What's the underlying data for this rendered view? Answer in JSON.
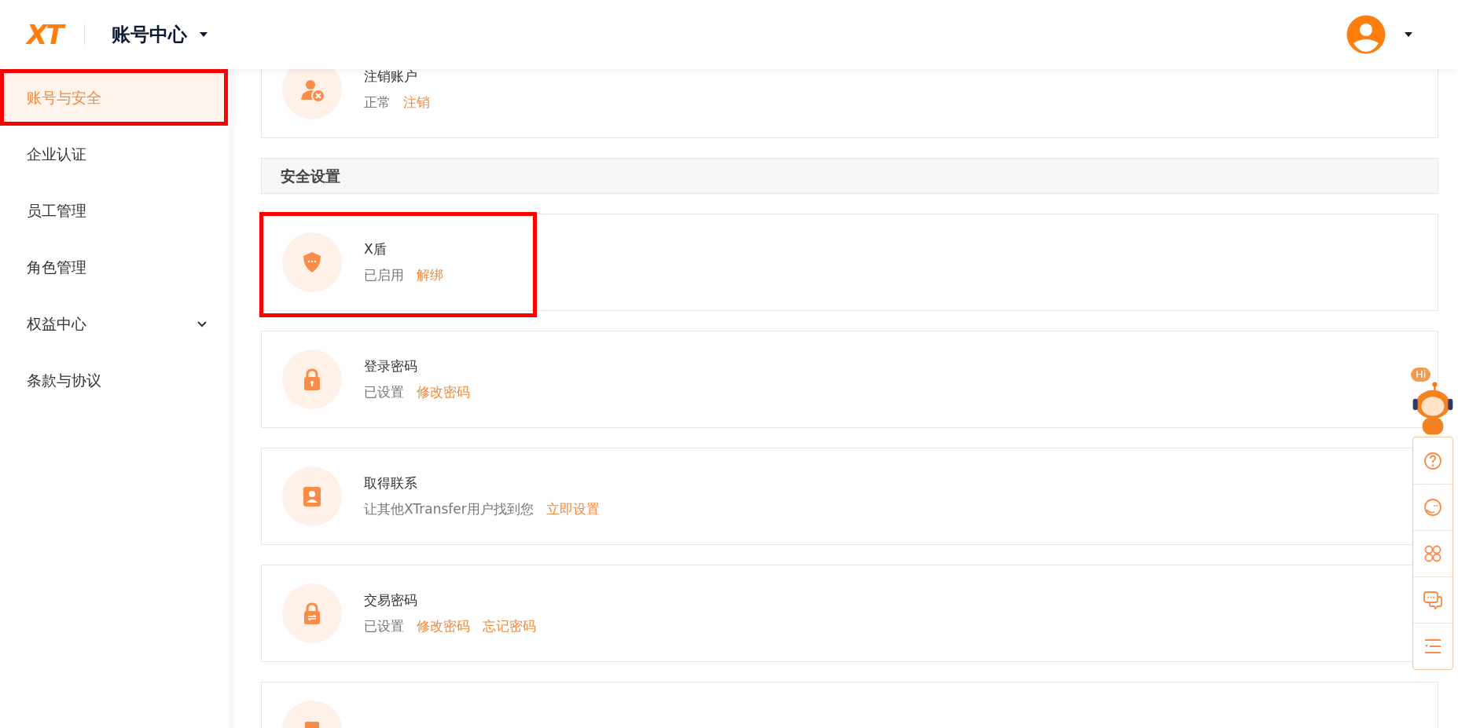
{
  "header": {
    "logo": "XT",
    "title": "账号中心"
  },
  "sidebar": {
    "items": [
      {
        "label": "账号与安全",
        "selected": true,
        "annotated": true,
        "kind": "link"
      },
      {
        "label": "企业认证",
        "selected": false,
        "annotated": false,
        "kind": "link"
      },
      {
        "label": "员工管理",
        "selected": false,
        "annotated": false,
        "kind": "link"
      },
      {
        "label": "角色管理",
        "selected": false,
        "annotated": false,
        "kind": "link"
      },
      {
        "label": "权益中心",
        "selected": false,
        "annotated": false,
        "kind": "group",
        "expanded": false
      },
      {
        "label": "条款与协议",
        "selected": false,
        "annotated": false,
        "kind": "link"
      }
    ]
  },
  "blocks": [
    {
      "kind": "card",
      "title": "注销账户",
      "status": "正常",
      "actions": [
        "注销"
      ],
      "annotated": false
    },
    {
      "kind": "heading",
      "title": "安全设置"
    },
    {
      "kind": "card",
      "title": "X盾",
      "status": "已启用",
      "actions": [
        "解绑"
      ],
      "annotated": true
    },
    {
      "kind": "card",
      "title": "登录密码",
      "status": "已设置",
      "actions": [
        "修改密码"
      ],
      "annotated": false
    },
    {
      "kind": "card",
      "title": "取得联系",
      "status": "让其他XTransfer用户找到您",
      "actions": [
        "立即设置"
      ],
      "annotated": false
    },
    {
      "kind": "card",
      "title": "交易密码",
      "status": "已设置",
      "actions": [
        "修改密码",
        "忘记密码"
      ],
      "annotated": false
    },
    {
      "kind": "card",
      "annotated": false
    }
  ],
  "help_widget": {
    "bubble": "Hi"
  }
}
